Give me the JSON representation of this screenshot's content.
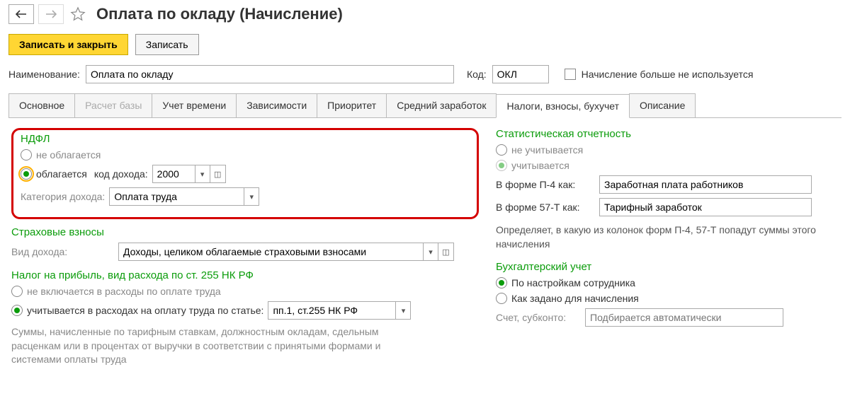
{
  "header": {
    "title": "Оплата по окладу (Начисление)"
  },
  "toolbar": {
    "save_close": "Записать и закрыть",
    "save": "Записать"
  },
  "fields": {
    "name_label": "Наименование:",
    "name_value": "Оплата по окладу",
    "code_label": "Код:",
    "code_value": "ОКЛ",
    "unused_label": "Начисление больше не используется"
  },
  "tabs": [
    "Основное",
    "Расчет базы",
    "Учет времени",
    "Зависимости",
    "Приоритет",
    "Средний заработок",
    "Налоги, взносы, бухучет",
    "Описание"
  ],
  "ndfl": {
    "title": "НДФЛ",
    "not_taxed": "не облагается",
    "taxed": "облагается",
    "code_label": "код дохода:",
    "code_value": "2000",
    "category_label": "Категория дохода:",
    "category_value": "Оплата труда"
  },
  "insurance": {
    "title": "Страховые взносы",
    "type_label": "Вид дохода:",
    "type_value": "Доходы, целиком облагаемые страховыми взносами"
  },
  "profit_tax": {
    "title": "Налог на прибыль, вид расхода по ст. 255 НК РФ",
    "not_included": "не включается в расходы по оплате труда",
    "included": "учитывается в расходах на оплату труда по статье:",
    "article_value": "пп.1, ст.255 НК РФ",
    "desc": "Суммы, начисленные по тарифным ставкам, должностным окладам, сдельным расценкам или в процентах от выручки в соответствии с принятыми формами и системами оплаты труда"
  },
  "stats": {
    "title": "Статистическая отчетность",
    "not_counted": "не учитывается",
    "counted": "учитывается",
    "p4_label": "В форме П-4 как:",
    "p4_value": "Заработная плата работников",
    "t57_label": "В форме 57-Т как:",
    "t57_value": "Тарифный заработок",
    "desc": "Определяет, в какую из колонок форм П-4, 57-Т попадут суммы этого начисления"
  },
  "accounting": {
    "title": "Бухгалтерский учет",
    "by_employee": "По настройкам сотрудника",
    "by_accrual": "Как задано для начисления",
    "account_label": "Счет, субконто:",
    "account_placeholder": "Подбирается автоматически"
  }
}
